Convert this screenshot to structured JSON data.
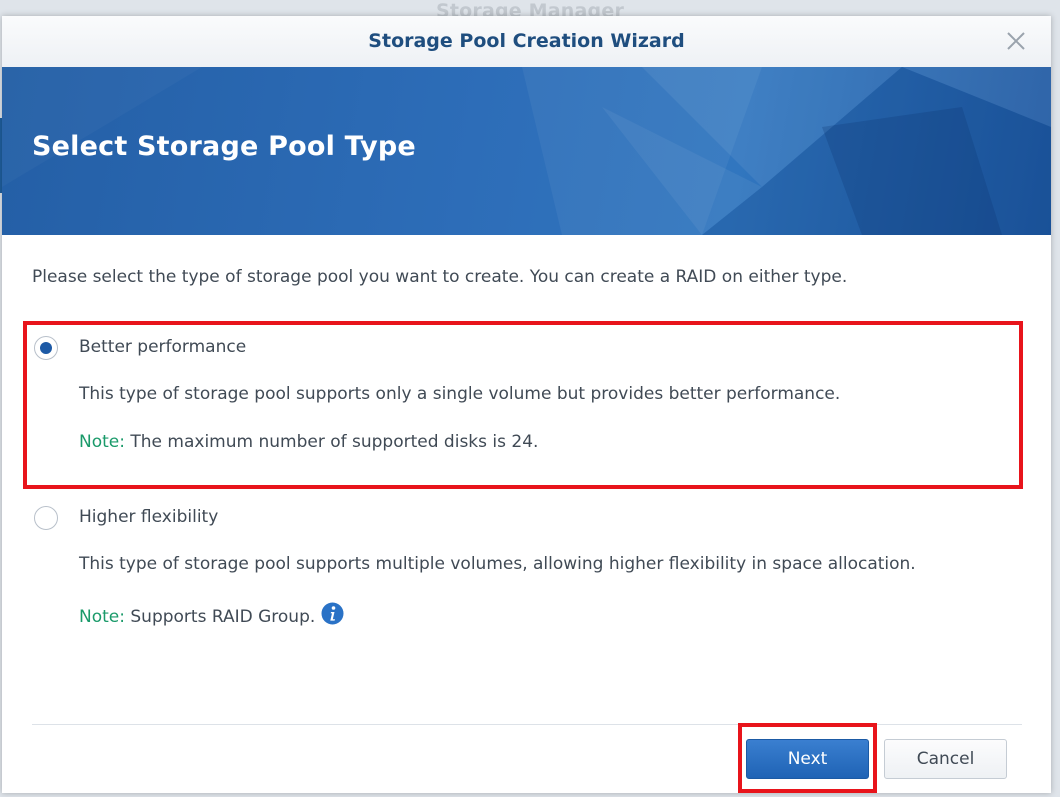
{
  "background": {
    "app_title": "Storage Manager"
  },
  "dialog": {
    "title": "Storage Pool Creation Wizard",
    "close_icon": "close-icon",
    "banner_title": "Select Storage Pool Type",
    "intro": "Please select the type of storage pool you want to create. You can create a RAID on either type.",
    "options": [
      {
        "label": "Better performance",
        "selected": true,
        "description": "This type of storage pool supports only a single volume but provides better performance.",
        "note_label": "Note:",
        "note_text": " The maximum number of supported disks is 24."
      },
      {
        "label": "Higher flexibility",
        "selected": false,
        "description": "This type of storage pool supports multiple volumes, allowing higher flexibility in space allocation.",
        "note_label": "Note:",
        "note_text": " Supports RAID Group.",
        "info_icon": "info-icon"
      }
    ],
    "buttons": {
      "next": "Next",
      "cancel": "Cancel"
    }
  },
  "colors": {
    "accent": "#1d5aa6",
    "title_text": "#1f4e7f",
    "note": "#1a9a6a",
    "highlight": "#e8141b",
    "banner": "#2d6db8"
  }
}
